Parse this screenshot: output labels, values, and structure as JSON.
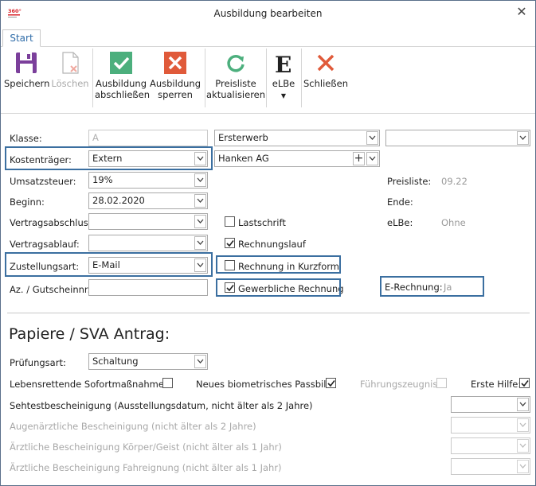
{
  "window": {
    "title": "Ausbildung bearbeiten"
  },
  "tabs": [
    {
      "label": "Start"
    }
  ],
  "ribbon": {
    "save": "Speichern",
    "delete": "Löschen",
    "complete_1": "Ausbildung",
    "complete_2": "abschließen",
    "block_1": "Ausbildung",
    "block_2": "sperren",
    "pricelist_1": "Preisliste",
    "pricelist_2": "aktualisieren",
    "elbe": "eLBe",
    "close": "Schließen"
  },
  "colors": {
    "accent": "#3b6fa0",
    "check_green": "#4caf7d",
    "red": "#e05a3a"
  },
  "form": {
    "klasse_label": "Klasse:",
    "klasse_value": "A",
    "erwerb_value": "Ersterwerb",
    "erwerb2_value": "",
    "kostentraeger_label": "Kostenträger:",
    "kostentraeger_value": "Extern",
    "company_value": "Hanken AG",
    "ust_label": "Umsatzsteuer:",
    "ust_value": "19%",
    "preisliste_label": "Preisliste:",
    "preisliste_value": "09.22",
    "beginn_label": "Beginn:",
    "beginn_value": "28.02.2020",
    "ende_label": "Ende:",
    "vertragsabschluss_label": "Vertragsabschluss:",
    "vertragsabschluss_value": "",
    "lastschrift_label": "Lastschrift",
    "elbe_label": "eLBe:",
    "elbe_value": "Ohne",
    "vertragsablauf_label": "Vertragsablauf:",
    "vertragsablauf_value": "",
    "rechnungslauf_label": "Rechnungslauf",
    "zustellungsart_label": "Zustellungsart:",
    "zustellungsart_value": "E-Mail",
    "kurzform_label": "Rechnung in Kurzform",
    "az_label": "Az. / Gutscheinnr.:",
    "az_value": "",
    "gewerblich_label": "Gewerbliche Rechnung",
    "erechnung_label": "E-Rechnung:",
    "erechnung_value": "Ja"
  },
  "papers": {
    "title": "Papiere / SVA Antrag:",
    "pruefungsart_label": "Prüfungsart:",
    "pruefungsart_value": "Schaltung",
    "lebensrettend_label": "Lebensrettende Sofortmaßnahmen:",
    "passbild_label": "Neues biometrisches Passbild:",
    "fuehrungszeugnis_label": "Führungszeugnis:",
    "erstehilfe_label": "Erste Hilfe:",
    "sehtest_label": "Sehtestbescheinigung (Ausstellungsdatum, nicht älter als 2 Jahre)",
    "augenarzt_label": "Augenärztliche Bescheinigung (nicht älter als 2 Jahre)",
    "koerper_label": "Ärztliche Bescheinigung Körper/Geist (nicht älter als 1 Jahr)",
    "fahreignung_label": "Ärztliche Bescheinigung Fahreignung (nicht älter als 1 Jahr)"
  }
}
